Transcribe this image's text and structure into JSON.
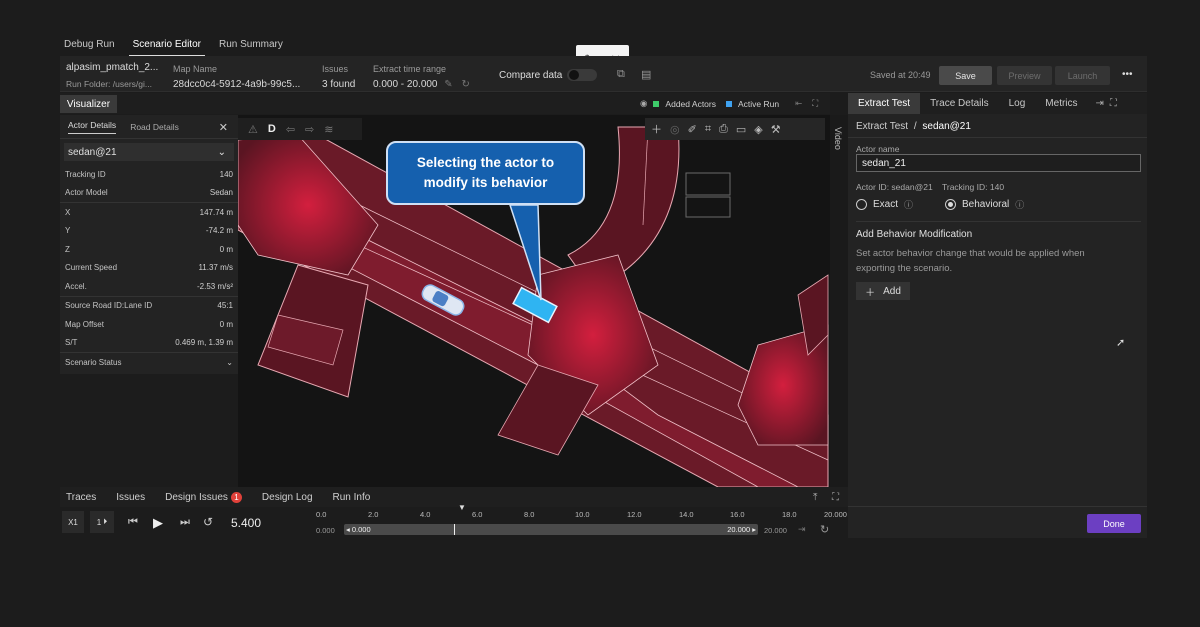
{
  "nav": {
    "tabs": [
      "Debug Run",
      "Scenario Editor",
      "Run Summary"
    ],
    "active": 1
  },
  "header": {
    "run_name": "alpasim_pmatch_2...",
    "run_folder": "Run Folder: /users/gi...",
    "map_label": "Map Name",
    "map_value": "28dcc0c4-5912-4a9b-99c5...",
    "issues_label": "Issues",
    "issues_value": "3 found",
    "range_label": "Extract time range",
    "range_value": "0.000 - 20.000",
    "compare_label": "Compare data",
    "saved": "Saved at 20:49",
    "save": "Save",
    "preview": "Preview",
    "launch": "Launch",
    "more": "•••"
  },
  "visualizer": {
    "tab": "Visualizer",
    "legend_added": "Added Actors",
    "legend_active": "Active Run",
    "color_added": "#3ecb6a",
    "color_active": "#3fa2f0",
    "video": "Video",
    "mode_letter": "D"
  },
  "actor_panel": {
    "tabs": [
      "Actor Details",
      "Road Details"
    ],
    "selected": "sedan@21",
    "rows": [
      {
        "label": "Tracking ID",
        "value": "140"
      },
      {
        "label": "Actor Model",
        "value": "Sedan"
      },
      {
        "label": "X",
        "value": "147.74 m"
      },
      {
        "label": "Y",
        "value": "-74.2 m"
      },
      {
        "label": "Z",
        "value": "0 m"
      },
      {
        "label": "Current Speed",
        "value": "11.37 m/s"
      },
      {
        "label": "Accel.",
        "value": "-2.53 m/s²"
      },
      {
        "label": "Source Road ID:Lane ID",
        "value": "45:1"
      },
      {
        "label": "Map Offset",
        "value": "0 m"
      },
      {
        "label": "S/T",
        "value": "0.469 m, 1.39 m"
      }
    ],
    "status": "Scenario Status"
  },
  "callout": {
    "line1": "Selecting the actor to",
    "line2": "modify its behavior"
  },
  "right_panel": {
    "tabs": [
      "Extract Test",
      "Trace Details",
      "Log",
      "Metrics"
    ],
    "breadcrumb_root": "Extract Test",
    "breadcrumb_sep": "/",
    "breadcrumb_leaf": "sedan@21",
    "actor_name_label": "Actor name",
    "actor_name_value": "sedan_21",
    "actor_id": "Actor ID: sedan@21",
    "tracking_id": "Tracking ID: 140",
    "opt_exact": "Exact",
    "opt_behavioral": "Behavioral",
    "section_title": "Add Behavior Modification",
    "section_desc1": "Set actor behavior change that would be applied when",
    "section_desc2": "exporting the scenario.",
    "add": "Add",
    "done": "Done"
  },
  "bottom_tabs": {
    "traces": "Traces",
    "issues": "Issues",
    "design_issues": "Design Issues",
    "design_issues_count": "1",
    "design_log": "Design Log",
    "run_info": "Run Info"
  },
  "player": {
    "speed": "X1",
    "step": "1",
    "time": "5.400",
    "ticks": [
      "0.0",
      "2.0",
      "4.0",
      "6.0",
      "8.0",
      "10.0",
      "12.0",
      "14.0",
      "16.0",
      "18.0",
      "20.000"
    ],
    "range_start": "0.000",
    "range_in": "0.000",
    "range_out": "20.000",
    "range_end": "20.000"
  }
}
